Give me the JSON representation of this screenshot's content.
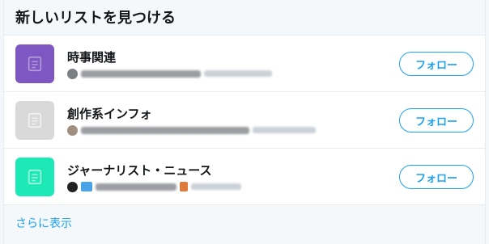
{
  "panel": {
    "title": "新しいリストを見つける",
    "show_more": "さらに表示"
  },
  "lists": [
    {
      "name": "時事関連",
      "thumb_color": "#7e57c2",
      "button": "フォロー",
      "icon": "list-icon"
    },
    {
      "name": "創作系インフォ",
      "thumb_color": "#d9d9d9",
      "button": "フォロー",
      "icon": "list-icon"
    },
    {
      "name": "ジャーナリスト・ニュース",
      "thumb_color": "#1de9b6",
      "button": "フォロー",
      "icon": "list-icon"
    }
  ],
  "colors": {
    "accent": "#1da1f2",
    "border": "#e6ecf0",
    "background": "#f5f8fa"
  }
}
